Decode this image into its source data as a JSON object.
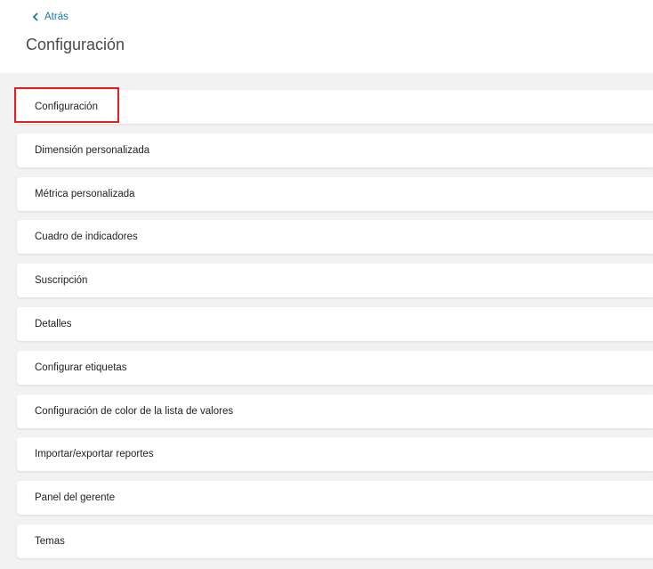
{
  "header": {
    "back_label": "Atrás",
    "title": "Configuración"
  },
  "menu": {
    "items": [
      {
        "label": "Configuración"
      },
      {
        "label": "Dimensión personalizada"
      },
      {
        "label": "Métrica personalizada"
      },
      {
        "label": "Cuadro de indicadores"
      },
      {
        "label": "Suscripción"
      },
      {
        "label": "Detalles"
      },
      {
        "label": "Configurar etiquetas"
      },
      {
        "label": "Configuración de color de la lista de valores"
      },
      {
        "label": "Importar/exportar reportes"
      },
      {
        "label": "Panel del gerente"
      },
      {
        "label": "Temas"
      }
    ]
  },
  "colors": {
    "accent": "#0f7fa3",
    "highlight": "#e02020",
    "background": "#f2f2f2"
  }
}
